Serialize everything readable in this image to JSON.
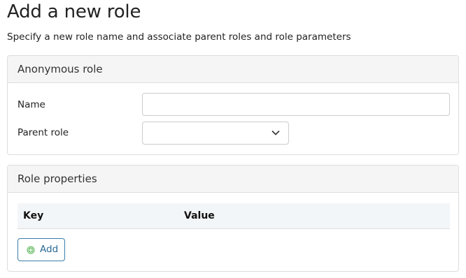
{
  "page": {
    "title": "Add a new role",
    "subtitle": "Specify a new role name and associate parent roles and role parameters"
  },
  "role_panel": {
    "header": "Anonymous role",
    "name_label": "Name",
    "name_value": "",
    "parent_label": "Parent role",
    "parent_selected": ""
  },
  "properties_panel": {
    "header": "Role properties",
    "columns": [
      "Key",
      "Value"
    ],
    "rows": [],
    "add_label": "Add"
  },
  "icons": {
    "select_chevron": "chevron-down-icon",
    "add_icon": "plus-circle-icon"
  },
  "colors": {
    "accent": "#2b6a93",
    "add_icon": "#5cb85c",
    "panel_header_bg": "#f5f5f5",
    "table_header_bg": "#f3f6f8"
  }
}
